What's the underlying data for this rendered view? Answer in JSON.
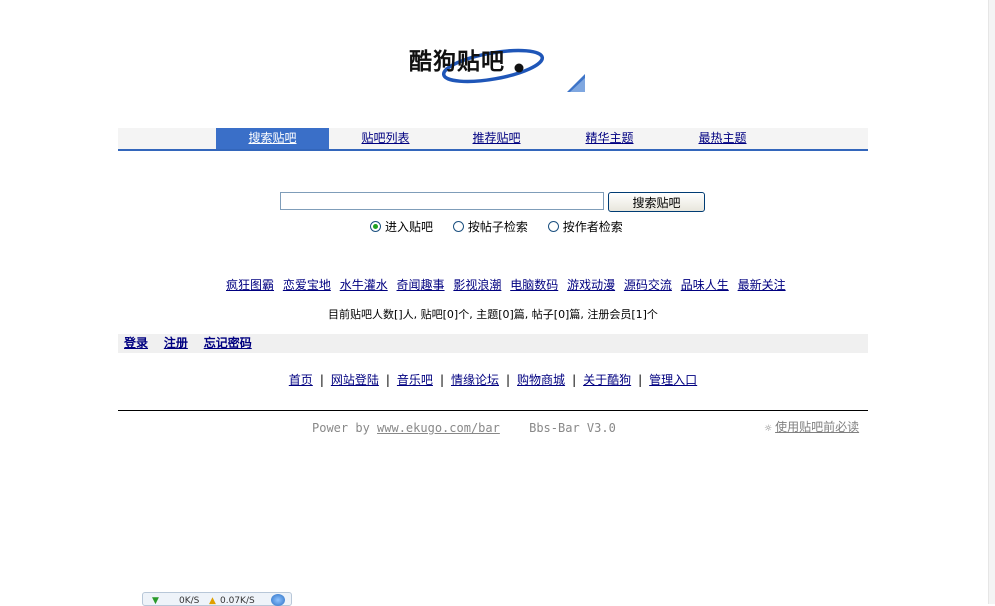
{
  "logo": {
    "text": "酷狗贴吧"
  },
  "nav": {
    "tabs": [
      {
        "label": "搜索贴吧",
        "active": true
      },
      {
        "label": "贴吧列表",
        "active": false
      },
      {
        "label": "推荐贴吧",
        "active": false
      },
      {
        "label": "精华主题",
        "active": false
      },
      {
        "label": "最热主题",
        "active": false
      }
    ]
  },
  "search": {
    "value": "",
    "button_label": "搜索贴吧",
    "options": [
      {
        "label": "进入贴吧",
        "checked": true
      },
      {
        "label": "按帖子检索",
        "checked": false
      },
      {
        "label": "按作者检索",
        "checked": false
      }
    ]
  },
  "categories": [
    "疯狂图霸",
    "恋爱宝地",
    "水牛灌水",
    "奇闻趣事",
    "影视浪潮",
    "电脑数码",
    "游戏动漫",
    "源码交流",
    "品味人生",
    "最新关注"
  ],
  "stats": {
    "text": "目前贴吧人数[]人, 贴吧[0]个, 主题[0]篇, 帖子[0]篇, 注册会员[1]个"
  },
  "login": {
    "links": [
      "登录",
      "注册",
      "忘记密码"
    ]
  },
  "footer": {
    "links": [
      "首页",
      "网站登陆",
      "音乐吧",
      "情缘论坛",
      "购物商城",
      "关于酷狗",
      "管理入口"
    ],
    "separator": "|",
    "power_prefix": "Power by",
    "power_link": "www.ekugo.com/bar",
    "version": "Bbs-Bar V3.0",
    "notice": "使用贴吧前必读"
  },
  "speed_widget": {
    "down": "0K/S",
    "up": "0.07K/S"
  },
  "colors": {
    "accent": "#3a6fc8",
    "link": "#000080",
    "nav_border": "#3366bb"
  }
}
